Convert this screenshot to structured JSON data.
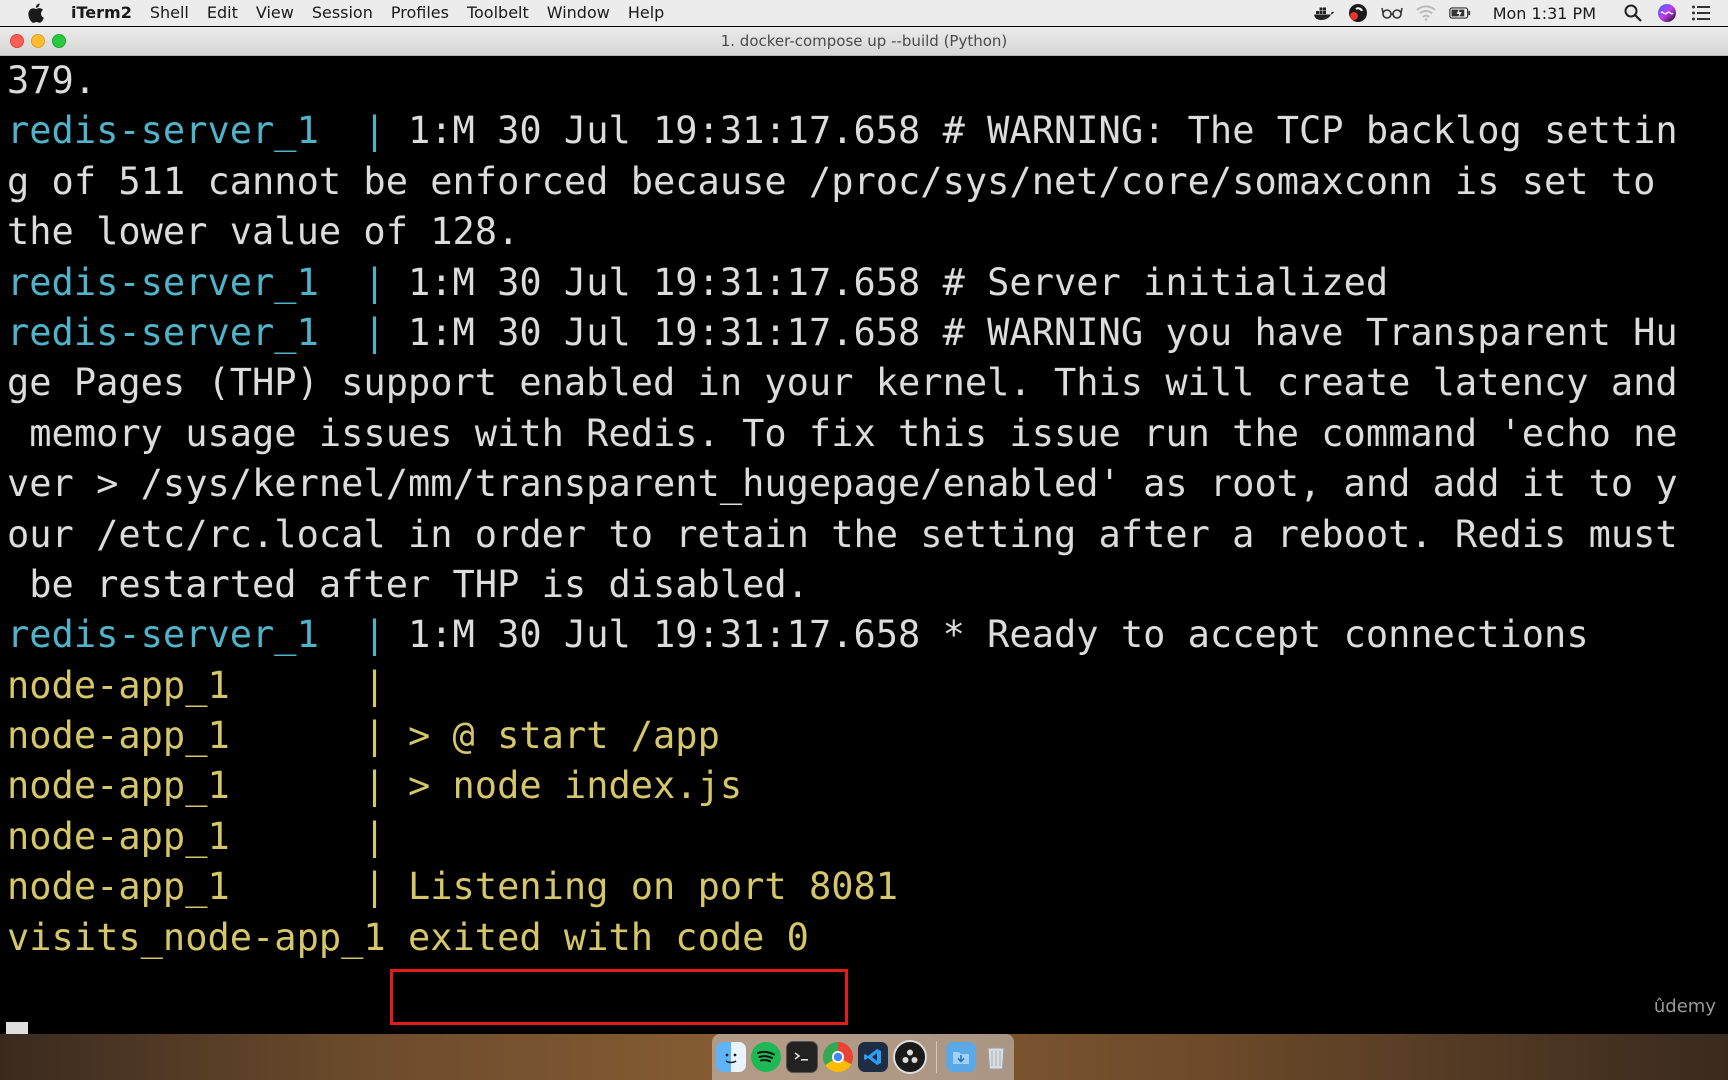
{
  "menubar": {
    "app_name": "iTerm2",
    "menus": [
      "Shell",
      "Edit",
      "View",
      "Session",
      "Profiles",
      "Toolbelt",
      "Window",
      "Help"
    ],
    "clock": "Mon 1:31 PM",
    "status_icons": [
      "docker-icon",
      "creative-cloud-icon",
      "glasses-icon",
      "wifi-icon",
      "battery-icon",
      "spotlight-search-icon",
      "siri-icon",
      "notification-center-icon"
    ]
  },
  "window": {
    "title": "1. docker-compose up --build (Python)"
  },
  "terminal": {
    "lines": [
      {
        "svc": "",
        "sep": "",
        "msg": "379.",
        "kind": "plain"
      },
      {
        "svc": "redis-server_1  ",
        "sep": "| ",
        "msg": "1:M 30 Jul 19:31:17.658 # WARNING: The TCP backlog settin",
        "kind": "redis"
      },
      {
        "svc": "",
        "sep": "",
        "msg": "g of 511 cannot be enforced because /proc/sys/net/core/somaxconn is set to",
        "kind": "plain"
      },
      {
        "svc": "",
        "sep": "",
        "msg": "the lower value of 128.",
        "kind": "plain"
      },
      {
        "svc": "redis-server_1  ",
        "sep": "| ",
        "msg": "1:M 30 Jul 19:31:17.658 # Server initialized",
        "kind": "redis"
      },
      {
        "svc": "redis-server_1  ",
        "sep": "| ",
        "msg": "1:M 30 Jul 19:31:17.658 # WARNING you have Transparent Hu",
        "kind": "redis"
      },
      {
        "svc": "",
        "sep": "",
        "msg": "ge Pages (THP) support enabled in your kernel. This will create latency and",
        "kind": "plain"
      },
      {
        "svc": "",
        "sep": "",
        "msg": " memory usage issues with Redis. To fix this issue run the command 'echo ne",
        "kind": "plain"
      },
      {
        "svc": "",
        "sep": "",
        "msg": "ver > /sys/kernel/mm/transparent_hugepage/enabled' as root, and add it to y",
        "kind": "plain"
      },
      {
        "svc": "",
        "sep": "",
        "msg": "our /etc/rc.local in order to retain the setting after a reboot. Redis must",
        "kind": "plain"
      },
      {
        "svc": "",
        "sep": "",
        "msg": " be restarted after THP is disabled.",
        "kind": "plain"
      },
      {
        "svc": "redis-server_1  ",
        "sep": "| ",
        "msg": "1:M 30 Jul 19:31:17.658 * Ready to accept connections",
        "kind": "redis"
      },
      {
        "svc": "node-app_1      ",
        "sep": "| ",
        "msg": "",
        "kind": "node"
      },
      {
        "svc": "node-app_1      ",
        "sep": "| ",
        "msg": "> @ start /app",
        "kind": "node"
      },
      {
        "svc": "node-app_1      ",
        "sep": "| ",
        "msg": "> node index.js",
        "kind": "node"
      },
      {
        "svc": "node-app_1      ",
        "sep": "| ",
        "msg": "",
        "kind": "node"
      },
      {
        "svc": "node-app_1      ",
        "sep": "| ",
        "msg": "Listening on port 8081",
        "kind": "node"
      },
      {
        "svc": "visits_node-app_1",
        "sep": " ",
        "msg": "exited with code 0",
        "kind": "exit"
      }
    ],
    "watermark": "ûdemy"
  },
  "dock": {
    "icons": [
      "finder-icon",
      "spotify-icon",
      "terminal-icon",
      "chrome-icon",
      "vscode-icon",
      "obs-icon",
      "downloads-folder-icon",
      "trash-icon"
    ]
  },
  "colors": {
    "redis_service": "#4fb3c9",
    "node_service": "#d5c66a",
    "highlight_box": "#e21b1b",
    "terminal_bg": "#000000",
    "terminal_fg": "#dcdcdc"
  }
}
